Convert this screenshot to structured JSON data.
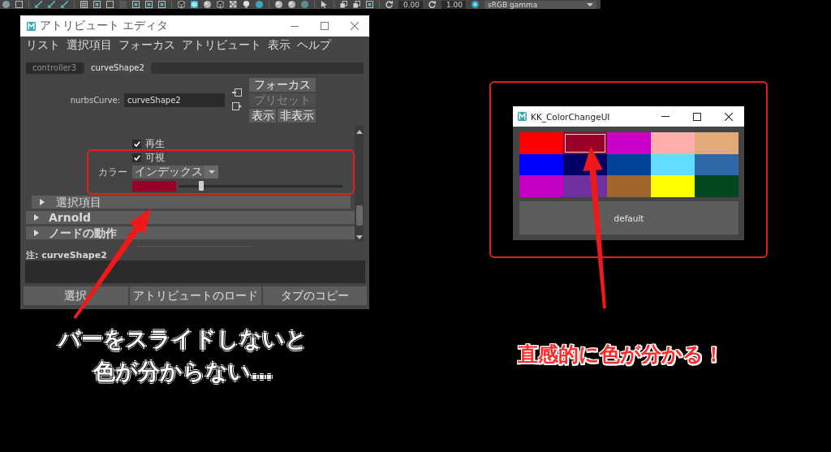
{
  "toolbar": {
    "fields": [
      "0.00",
      "1.00"
    ],
    "color_space": "sRGB gamma"
  },
  "attribute_editor": {
    "title": "アトリビュート エディタ",
    "menu": [
      "リスト",
      "選択項目",
      "フォーカス",
      "アトリビュート",
      "表示",
      "ヘルプ"
    ],
    "tabs": [
      {
        "label": "controller3",
        "selected": false
      },
      {
        "label": "curveShape2",
        "selected": true
      }
    ],
    "node": {
      "label": "nurbsCurve:",
      "value": "curveShape2"
    },
    "side_buttons": [
      {
        "label": "フォーカス",
        "disabled": false
      },
      {
        "label": "プリセット",
        "disabled": true
      }
    ],
    "view_buttons": [
      "表示",
      "非表示"
    ],
    "attributes": [
      {
        "kind": "checkbox",
        "label": "再生",
        "checked": true
      },
      {
        "kind": "checkbox",
        "label": "可視",
        "checked": true
      },
      {
        "kind": "dropdown",
        "label": "カラー",
        "value": "インデックス"
      },
      {
        "kind": "color_slider",
        "color": "#9b0028",
        "level": 0.14
      },
      {
        "kind": "section",
        "label": "選択項目",
        "expanded": false
      }
    ],
    "sections": [
      {
        "label": "Arnold",
        "expanded": false
      },
      {
        "label": "ノードの動作",
        "expanded": false
      }
    ],
    "notes_label": "注: curveShape2",
    "buttons": [
      "選択",
      "アトリビュートのロード",
      "タブのコピー"
    ]
  },
  "color_change_ui": {
    "title": "KK_ColorChangeUI",
    "swatches": [
      {
        "color": "#ff0000",
        "selected": false
      },
      {
        "color": "#9b0028",
        "selected": true
      },
      {
        "color": "#c800c8",
        "selected": false
      },
      {
        "color": "#ffadad",
        "selected": false
      },
      {
        "color": "#e2aa78",
        "selected": false
      },
      {
        "color": "#0000ff",
        "selected": false
      },
      {
        "color": "#000066",
        "selected": false
      },
      {
        "color": "#00449a",
        "selected": false
      },
      {
        "color": "#64dcff",
        "selected": false
      },
      {
        "color": "#3068a8",
        "selected": false
      },
      {
        "color": "#c400c4",
        "selected": false
      },
      {
        "color": "#7030a0",
        "selected": false
      },
      {
        "color": "#a0642c",
        "selected": false
      },
      {
        "color": "#ffff00",
        "selected": false
      },
      {
        "color": "#00461e",
        "selected": false
      }
    ],
    "default_button": "default"
  },
  "captions": [
    {
      "lines": [
        "バーをスライドしないと",
        "色が分からない…"
      ],
      "color": "#ffffff"
    },
    {
      "lines": [
        "直感的に色が分かる！"
      ],
      "color": "#ff2a2a"
    }
  ]
}
